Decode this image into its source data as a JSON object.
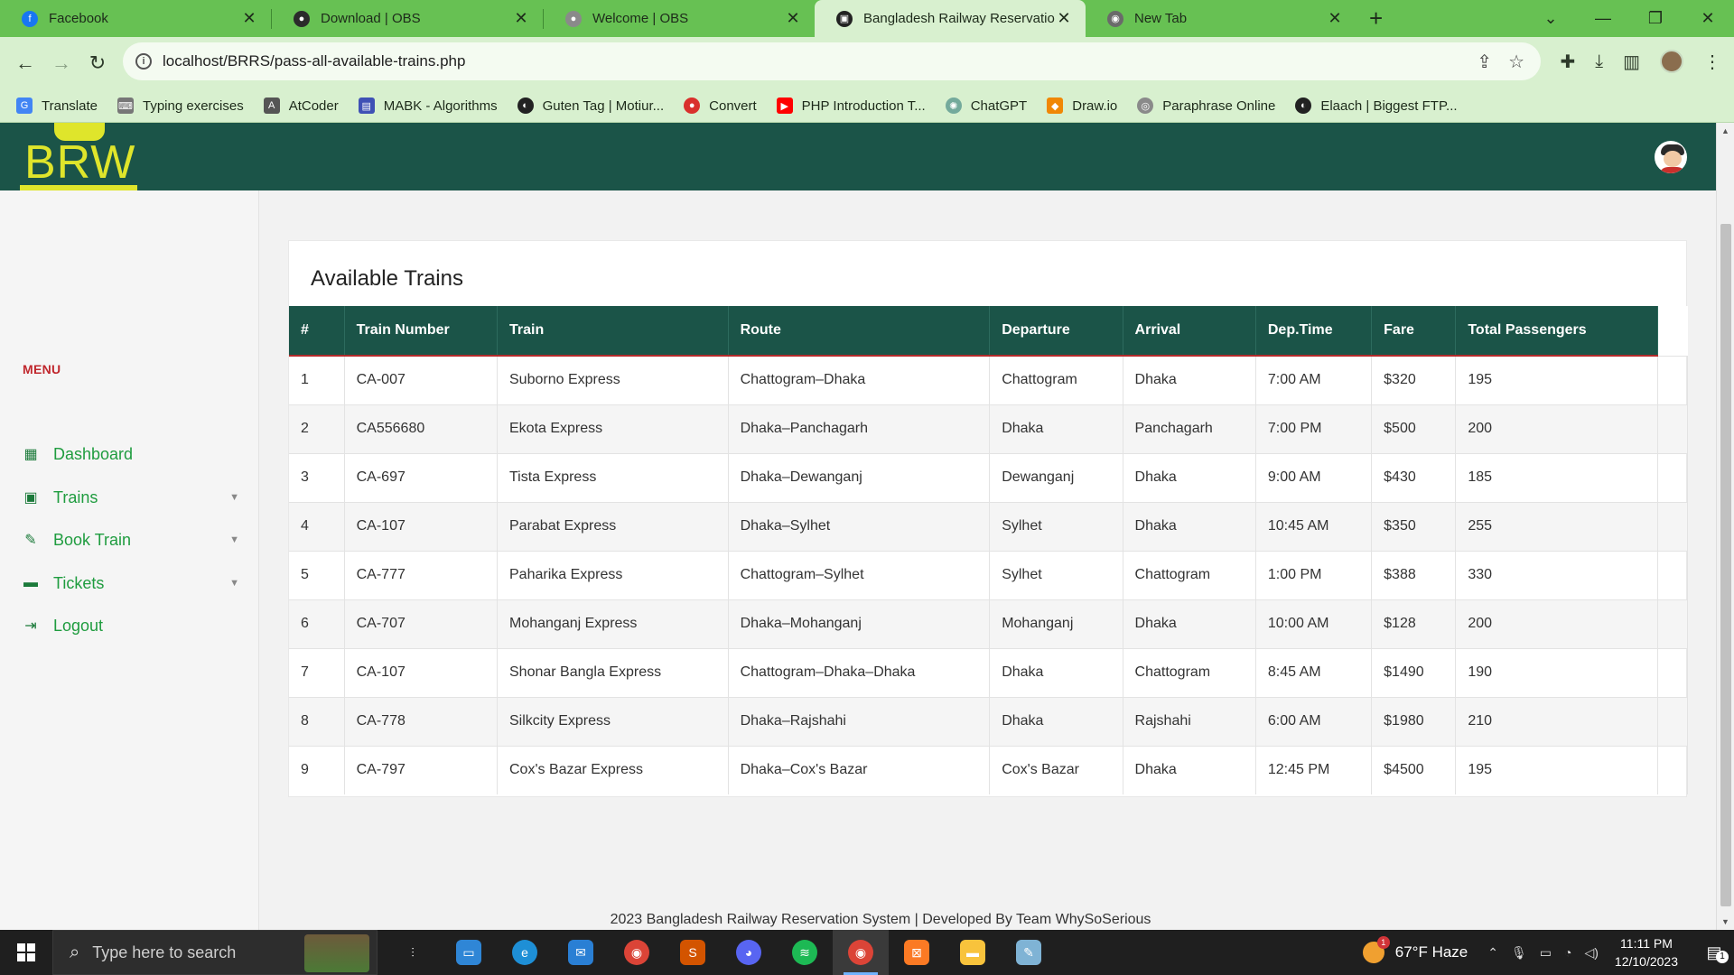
{
  "browser": {
    "tabs": [
      {
        "label": "Facebook",
        "icon": "facebook-icon",
        "color": "#1877f2"
      },
      {
        "label": "Download | OBS",
        "icon": "obs-icon",
        "color": "#2b2b2b"
      },
      {
        "label": "Welcome | OBS",
        "icon": "obs-icon",
        "color": "#8a8a8a"
      },
      {
        "label": "Bangladesh Railway Reservation",
        "icon": "train-icon",
        "color": "#222222"
      },
      {
        "label": "New Tab",
        "icon": "chrome-icon",
        "color": "#6a6a6a"
      }
    ],
    "url": "localhost/BRRS/pass-all-available-trains.php",
    "bookmarks": [
      {
        "label": "Translate",
        "color": "#4285f4"
      },
      {
        "label": "Typing exercises",
        "color": "#777777"
      },
      {
        "label": "AtCoder",
        "color": "#555555"
      },
      {
        "label": "MABK - Algorithms",
        "color": "#3f51b5"
      },
      {
        "label": "Guten Tag | Motiur...",
        "color": "#222222"
      },
      {
        "label": "Convert",
        "color": "#d9302c"
      },
      {
        "label": "PHP Introduction T...",
        "color": "#ff0000"
      },
      {
        "label": "ChatGPT",
        "color": "#74aa9c"
      },
      {
        "label": "Draw.io",
        "color": "#f08705"
      },
      {
        "label": "Paraphrase Online",
        "color": "#8a8a8a"
      },
      {
        "label": "Elaach | Biggest FTP...",
        "color": "#222222"
      }
    ]
  },
  "app": {
    "logo_text": "BRW",
    "menu_heading": "MENU",
    "menu": [
      {
        "label": "Dashboard",
        "icon": "dashboard-icon",
        "caret": false
      },
      {
        "label": "Trains",
        "icon": "train-icon",
        "caret": true
      },
      {
        "label": "Book Train",
        "icon": "book-icon",
        "caret": true
      },
      {
        "label": "Tickets",
        "icon": "ticket-icon",
        "caret": true
      },
      {
        "label": "Logout",
        "icon": "logout-icon",
        "caret": false
      }
    ],
    "card_title": "Available Trains",
    "columns": [
      "#",
      "Train Number",
      "Train",
      "Route",
      "Departure",
      "Arrival",
      "Dep.Time",
      "Fare",
      "Total Passengers"
    ],
    "rows": [
      [
        "1",
        "CA-007",
        "Suborno Express",
        "Chattogram–Dhaka",
        "Chattogram",
        "Dhaka",
        "7:00 AM",
        "$320",
        "195"
      ],
      [
        "2",
        "CA556680",
        "Ekota Express",
        "Dhaka–Panchagarh",
        "Dhaka",
        "Panchagarh",
        "7:00 PM",
        "$500",
        "200"
      ],
      [
        "3",
        "CA-697",
        "Tista Express",
        "Dhaka–Dewanganj",
        "Dewanganj",
        "Dhaka",
        "9:00 AM",
        "$430",
        "185"
      ],
      [
        "4",
        "CA-107",
        "Parabat Express",
        "Dhaka–Sylhet",
        "Sylhet",
        "Dhaka",
        "10:45 AM",
        "$350",
        "255"
      ],
      [
        "5",
        "CA-777",
        "Paharika Express",
        "Chattogram–Sylhet",
        "Sylhet",
        "Chattogram",
        "1:00 PM",
        "$388",
        "330"
      ],
      [
        "6",
        "CA-707",
        "Mohanganj Express",
        "Dhaka–Mohanganj",
        "Mohanganj",
        "Dhaka",
        "10:00 AM",
        "$128",
        "200"
      ],
      [
        "7",
        "CA-107",
        "Shonar Bangla Express",
        "Chattogram–Dhaka–Dhaka",
        "Dhaka",
        "Chattogram",
        "8:45 AM",
        "$1490",
        "190"
      ],
      [
        "8",
        "CA-778",
        "Silkcity Express",
        "Dhaka–Rajshahi",
        "Dhaka",
        "Rajshahi",
        "6:00 AM",
        "$1980",
        "210"
      ],
      [
        "9",
        "CA-797",
        "Cox's Bazar Express",
        "Dhaka–Cox's Bazar",
        "Cox's Bazar",
        "Dhaka",
        "12:45 PM",
        "$4500",
        "195"
      ]
    ],
    "footer": "2023 Bangladesh Railway Reservation System | Developed By Team WhySoSerious",
    "colors": {
      "header": "#1b5448",
      "accent": "#dfe52b",
      "menu_text": "#1f9c3f",
      "menu_heading": "#c0272d"
    }
  },
  "taskbar": {
    "search_placeholder": "Type here to search",
    "weather": "67°F  Haze",
    "weather_badge": "1",
    "time": "11:11 PM",
    "date": "12/10/2023",
    "notification_count": "1"
  }
}
